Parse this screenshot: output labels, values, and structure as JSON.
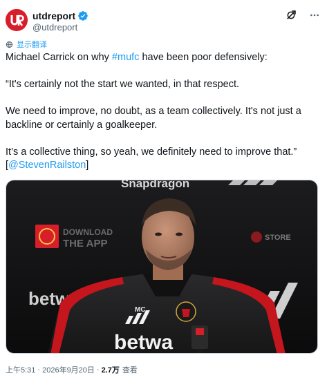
{
  "author": {
    "display_name": "utdreport",
    "handle": "@utdreport",
    "verified": true,
    "avatar_icon": "utdreport-logo-icon",
    "avatar_color": "#d81e2a"
  },
  "header_icons": [
    "grok-icon",
    "more-icon"
  ],
  "translate": {
    "icon": "translate-icon",
    "label": "显示翻译"
  },
  "tweet": {
    "line1_prefix": "Michael Carrick on why ",
    "line1_hashtag": "#mufc",
    "line1_suffix": " have been poor defensively:",
    "line2": "“It's certainly not the start we wanted, in that respect.",
    "line3": "We need to improve, no doubt, as a team collectively. It's not just a backline or certainly a goalkeeper.",
    "line4_prefix": "It’s a collective thing, so yeah, we definitely need to improve that.” [",
    "line4_mention": "@StevenRailston",
    "line4_suffix": "]"
  },
  "media": {
    "top_sponsor": "Snapdragon",
    "download_app_line1": "DOWNLOAD",
    "download_app_line2": "THE APP",
    "store_label": "STORE",
    "backboard_sponsor": "betwa",
    "shirt_sponsor": "betwa",
    "initials": "MC"
  },
  "meta": {
    "time": "上午5:31",
    "date": "2026年9月20日",
    "views_count": "2.7万",
    "views_label": "查看"
  },
  "colors": {
    "link": "#1d9bf0",
    "verified": "#1d9bf0",
    "brand_red": "#d81e2a"
  }
}
